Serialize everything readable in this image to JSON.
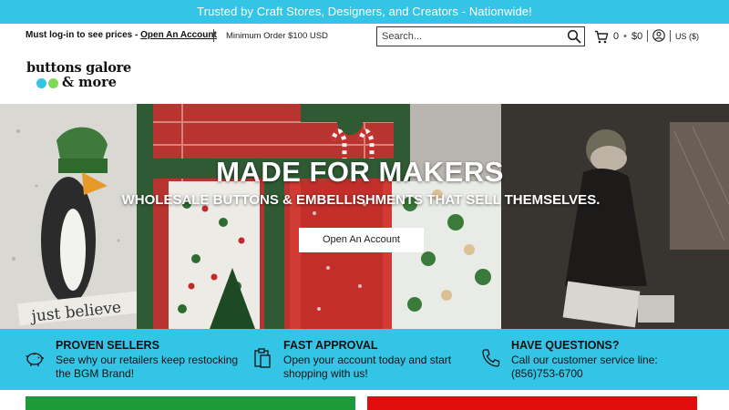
{
  "announcement": "Trusted by Craft Stores, Designers, and Creators - Nationwide!",
  "utility": {
    "login_prefix": "Must log-in to see prices - ",
    "login_link": "Open An Account",
    "minimum_order": "Minimum Order $100 USD",
    "currency": "US ($)"
  },
  "search": {
    "placeholder": "Search..."
  },
  "cart": {
    "count": "0",
    "separator": "•",
    "total": "$0"
  },
  "logo": {
    "line1": "buttons galore",
    "word2": "& more",
    "dot_colors": [
      "#34c5e6",
      "#7ed957",
      "#222222"
    ]
  },
  "hero": {
    "title": "MADE FOR MAKERS",
    "subtitle": "WHOLESALE BUTTONS & EMBELLISHMENTS THAT SELL THEMSELVES.",
    "cta": "Open An Account",
    "sign_text": "just believe"
  },
  "features": [
    {
      "icon": "piggy-bank-icon",
      "title": "PROVEN SELLERS",
      "desc": "See why our retailers keep restocking the BGM Brand!"
    },
    {
      "icon": "clipboard-icon",
      "title": "FAST APPROVAL",
      "desc": "Open your account today and start shopping with us!"
    },
    {
      "icon": "phone-icon",
      "title": "HAVE QUESTIONS?",
      "desc": "Call our customer service line: (856)753-6700"
    }
  ],
  "colors": {
    "accent": "#34c5e6",
    "green_block": "#1d9a39",
    "red_block": "#e20e0e"
  }
}
